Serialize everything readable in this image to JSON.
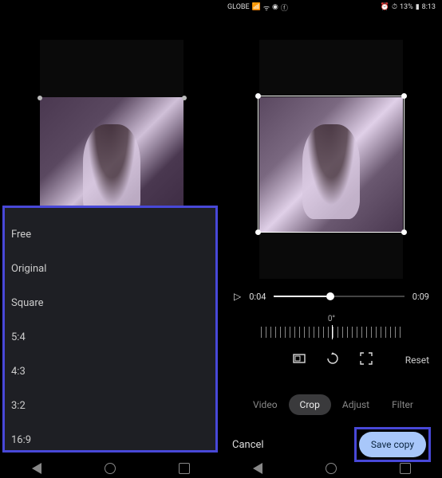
{
  "status_bar": {
    "carrier": "GLOBE",
    "signal_icons": "📶",
    "wifi_icon": "📶",
    "alarm_icon": "⏰",
    "battery_percent": "13%",
    "time": "8:13"
  },
  "aspect_ratio_menu": {
    "items": [
      "Free",
      "Original",
      "Square",
      "5:4",
      "4:3",
      "3:2",
      "16:9"
    ]
  },
  "video_player": {
    "current_time": "0:04",
    "total_time": "0:09",
    "progress_percent": 40
  },
  "rotation": {
    "angle_label": "0°"
  },
  "tools": {
    "aspect_icon": "aspect",
    "rotate_icon": "rotate",
    "expand_icon": "expand",
    "reset_label": "Reset"
  },
  "tabs": [
    {
      "label": "Video",
      "active": false
    },
    {
      "label": "Crop",
      "active": true
    },
    {
      "label": "Adjust",
      "active": false
    },
    {
      "label": "Filter",
      "active": false
    }
  ],
  "actions": {
    "cancel_label": "Cancel",
    "save_label": "Save copy"
  }
}
